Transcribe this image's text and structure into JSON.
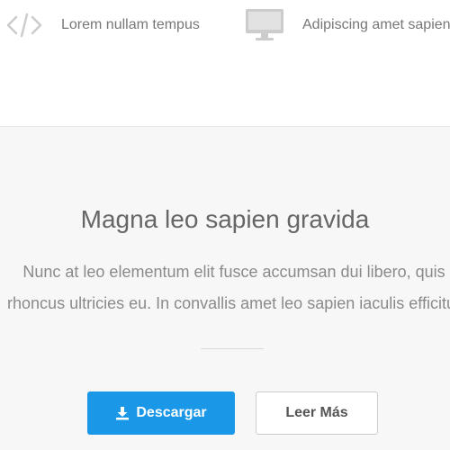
{
  "features": [
    {
      "icon": "code-icon",
      "label": "Lorem nullam tempus"
    },
    {
      "icon": "monitor-icon",
      "label": "Adipiscing amet sapien"
    }
  ],
  "hero": {
    "title": "Magna leo sapien gravida",
    "text_line_1": "Nunc at leo elementum elit fusce accumsan dui libero, quis",
    "text_line_2": "rhoncus ultricies eu. In convallis amet leo sapien iaculis efficitur",
    "primary_button": {
      "icon": "download-icon",
      "label": "Descargar"
    },
    "secondary_button": {
      "label": "Leer Más"
    }
  },
  "colors": {
    "accent": "#1a97e6",
    "hero_background": "#f7f7f7",
    "icon_gray": "#cccccc"
  }
}
